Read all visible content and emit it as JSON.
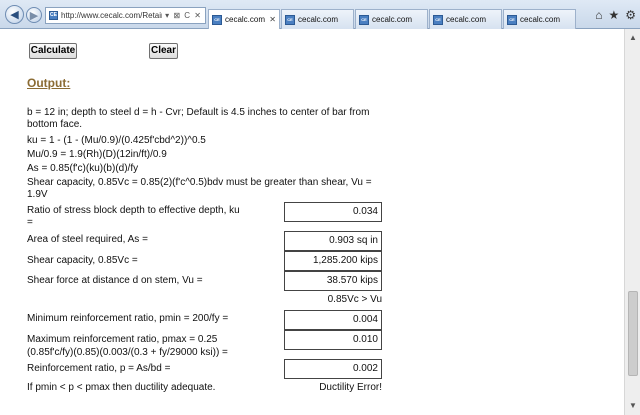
{
  "browser": {
    "address": "http://www.cecalc.com/Retaining",
    "address_icons": "▾ ⊠ C ✕",
    "favicon_text": "CE",
    "tabs": [
      {
        "label": "cecalc.com",
        "active": true
      },
      {
        "label": "cecalc.com",
        "active": false
      },
      {
        "label": "cecalc.com",
        "active": false
      },
      {
        "label": "cecalc.com",
        "active": false
      },
      {
        "label": "cecalc.com",
        "active": false
      }
    ],
    "icons": [
      "home-icon",
      "star-icon",
      "gear-icon"
    ]
  },
  "buttons": {
    "calculate": "Calculate",
    "clear": "Clear"
  },
  "output": {
    "title": "Output:",
    "notes": [
      "b = 12 in; depth to steel d = h - Cvr; Default is 4.5 inches to center of bar from bottom face.",
      "ku = 1 - (1 - (Mu/0.9)/(0.425f'cbd^2))^0.5",
      "Mu/0.9 = 1.9(Rh)(D)(12in/ft)/0.9",
      "As = 0.85(f'c)(ku)(b)(d)/fy",
      "Shear capacity, 0.85Vc = 0.85(2)(f'c^0.5)bdv must be greater than shear, Vu = 1.9V"
    ],
    "fields": {
      "ku": {
        "label_line1": "Ratio of stress block depth to effective depth, ku",
        "label_line2": "=",
        "value": "0.034"
      },
      "as": {
        "label": "Area of steel required, As =",
        "value": "0.903 sq in"
      },
      "vc": {
        "label": "Shear capacity, 0.85Vc =",
        "value": "1,285.200 kips"
      },
      "vu": {
        "label": "Shear force at distance d on stem, Vu =",
        "value": "38.570 kips"
      },
      "shear_check": "0.85Vc > Vu",
      "pmin": {
        "label": "Minimum reinforcement ratio, pmin = 200/fy =",
        "value": "0.004"
      },
      "pmax": {
        "label_line1": "Maximum reinforcement ratio, pmax = 0.25",
        "label_line2": "(0.85f'c/fy)(0.85)(0.003/(0.3 + fy/29000 ksi)) =",
        "value": "0.010"
      },
      "p": {
        "label": "Reinforcement ratio, p = As/bd =",
        "value": "0.002"
      },
      "ductility": {
        "label": "If pmin < p < pmax then ductility adequate.",
        "result": "Ductility Error!"
      }
    }
  },
  "colors": {
    "output_title": "#8b6b33"
  }
}
